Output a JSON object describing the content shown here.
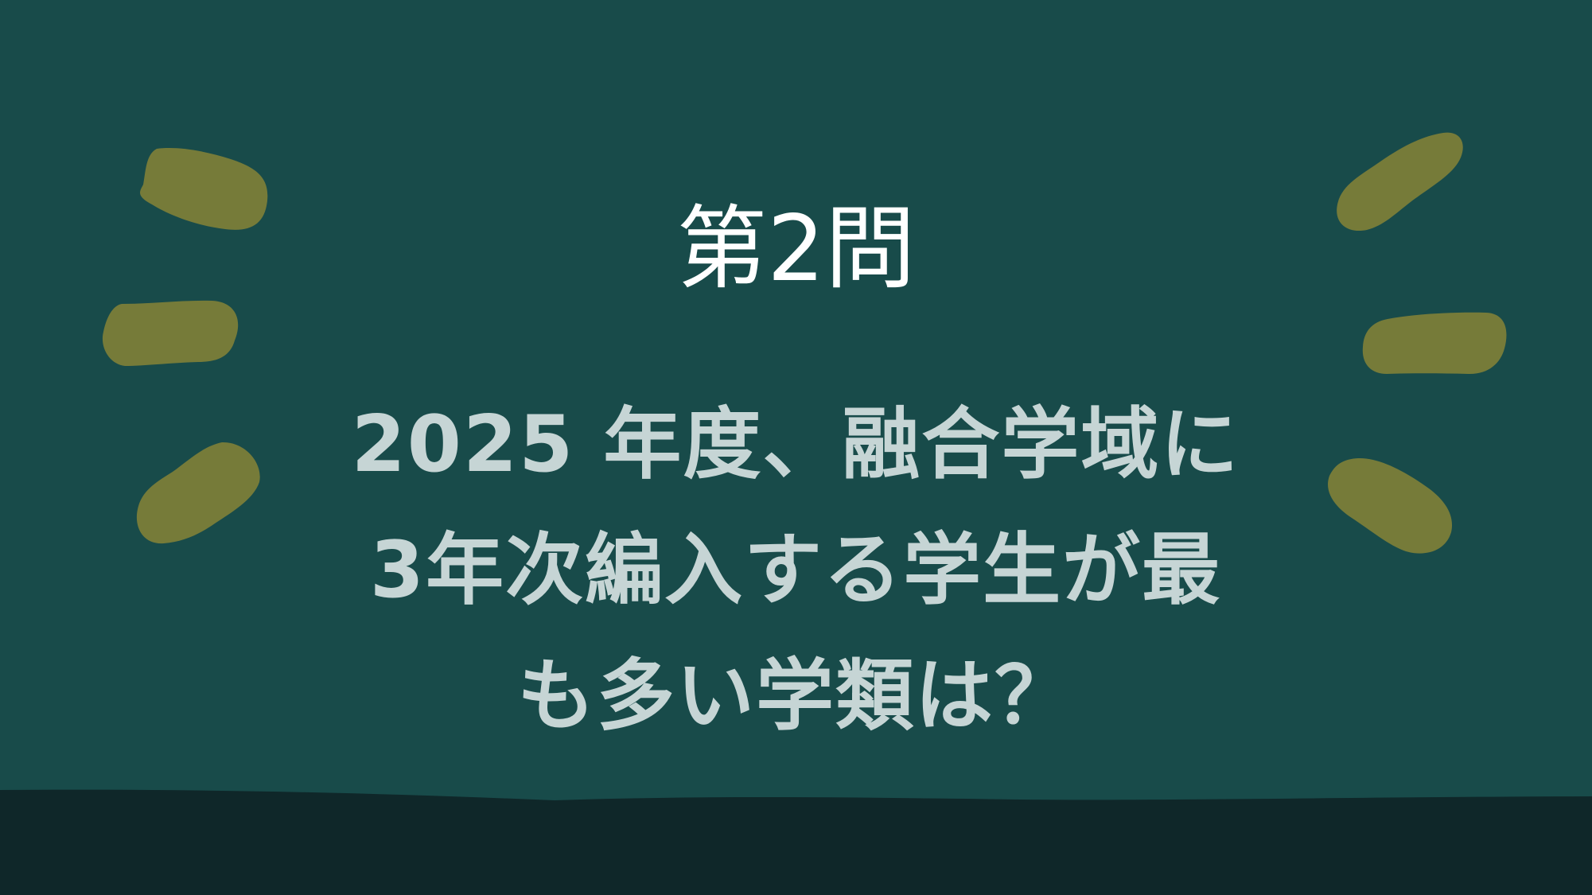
{
  "slide": {
    "question_number": "第2問",
    "question_lines": [
      "2025 年度、融合学域に",
      "3年次編入する学生が最",
      "も多い学類は？"
    ]
  },
  "colors": {
    "background": "#184b4a",
    "ground": "#0f2729",
    "accent_marks": "#767b39",
    "title_text": "#ffffff",
    "question_text": "#c6d5d5"
  }
}
